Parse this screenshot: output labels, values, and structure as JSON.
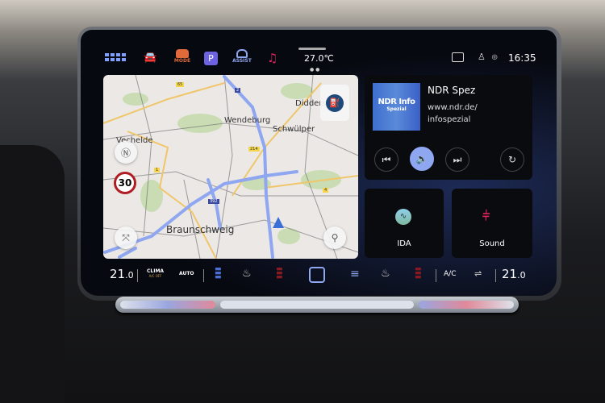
{
  "status_bar": {
    "temperature": "27.0℃",
    "time": "16:35",
    "icons": [
      "apps-grid-icon",
      "car-icon",
      "drive-mode-icon",
      "parking-icon",
      "assist-icon",
      "music-icon",
      "message-icon",
      "user-icon",
      "globe-icon"
    ],
    "mode_label": "MODE",
    "assist_label": "ASSIST",
    "parking_label": "P"
  },
  "map": {
    "places": [
      "Vechelde",
      "Wendeburg",
      "Schwülper",
      "Didderse",
      "Braunschweig"
    ],
    "road_shields": [
      "65",
      "2",
      "214",
      "1",
      "4",
      "392"
    ],
    "speed_limit": "30",
    "route_color": "#8fa6f0"
  },
  "media": {
    "station": "NDR Spez",
    "url_line1": "www.ndr.de/",
    "url_line2": "infospezial",
    "logo_text": "NDR Info",
    "logo_sub": "Spezial"
  },
  "tiles": {
    "ida": "IDA",
    "sound": "Sound"
  },
  "climate": {
    "left_temp": "21",
    "left_dec": ".0",
    "clima": "CLIMA",
    "ac_off": "A/C OFF",
    "auto": "AUTO",
    "ac": "A/C",
    "right_temp": "21",
    "right_dec": ".0"
  },
  "colors": {
    "accent": "#8fa6f0",
    "sound": "#e0245e"
  }
}
